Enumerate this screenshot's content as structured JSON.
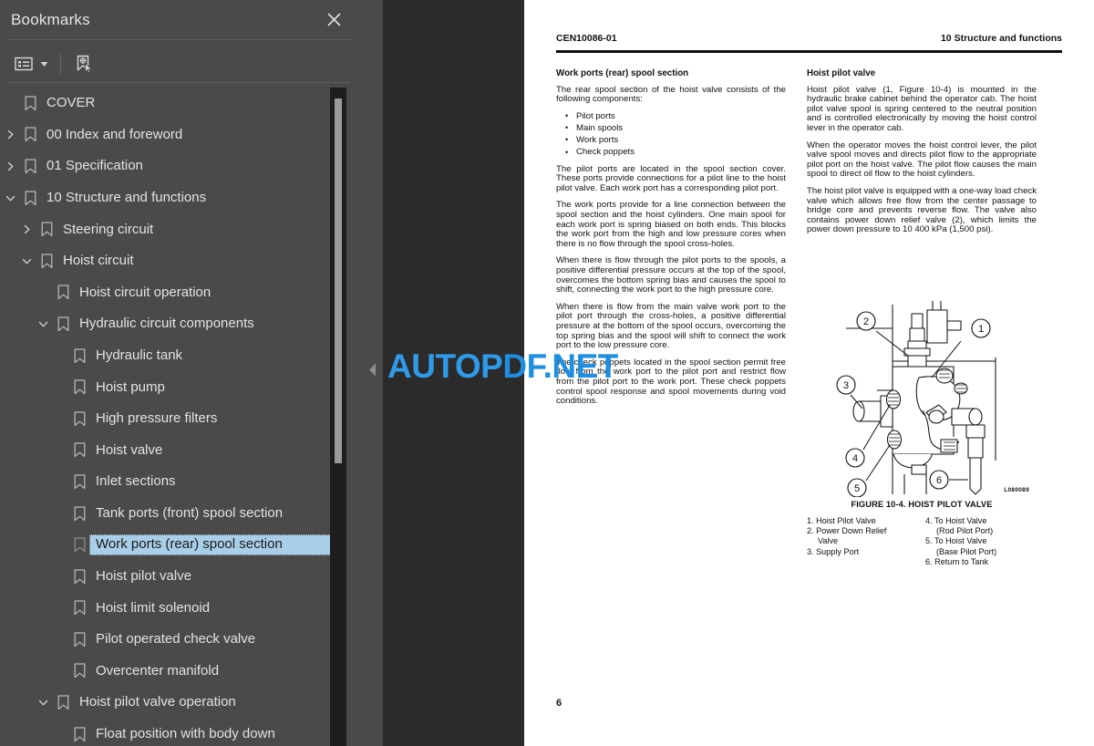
{
  "sidebar": {
    "title": "Bookmarks",
    "close_icon": "close-icon",
    "toolbar": {
      "options_icon": "list-options-icon",
      "caret_icon": "chevron-down-icon",
      "new_bookmark_icon": "new-bookmark-cursor-icon"
    },
    "tree": [
      {
        "label": "COVER",
        "level": 0,
        "state": "leaf"
      },
      {
        "label": "00 Index and foreword",
        "level": 0,
        "state": "collapsed"
      },
      {
        "label": "01 Specification",
        "level": 0,
        "state": "collapsed"
      },
      {
        "label": "10 Structure and functions",
        "level": 0,
        "state": "expanded"
      },
      {
        "label": "Steering circuit",
        "level": 1,
        "state": "collapsed"
      },
      {
        "label": "Hoist circuit",
        "level": 1,
        "state": "expanded"
      },
      {
        "label": "Hoist circuit operation",
        "level": 2,
        "state": "leaf"
      },
      {
        "label": "Hydraulic circuit components",
        "level": 2,
        "state": "expanded"
      },
      {
        "label": "Hydraulic tank",
        "level": 3,
        "state": "leaf"
      },
      {
        "label": "Hoist pump",
        "level": 3,
        "state": "leaf"
      },
      {
        "label": "High pressure filters",
        "level": 3,
        "state": "leaf"
      },
      {
        "label": "Hoist valve",
        "level": 3,
        "state": "leaf"
      },
      {
        "label": "Inlet sections",
        "level": 3,
        "state": "leaf"
      },
      {
        "label": "Tank ports (front) spool section",
        "level": 3,
        "state": "leaf"
      },
      {
        "label": "Work ports (rear) spool section",
        "level": 3,
        "state": "leaf",
        "selected": true
      },
      {
        "label": "Hoist pilot valve",
        "level": 3,
        "state": "leaf"
      },
      {
        "label": "Hoist limit solenoid",
        "level": 3,
        "state": "leaf"
      },
      {
        "label": "Pilot operated check valve",
        "level": 3,
        "state": "leaf"
      },
      {
        "label": "Overcenter manifold",
        "level": 3,
        "state": "leaf"
      },
      {
        "label": "Hoist pilot valve operation",
        "level": 2,
        "state": "expanded"
      },
      {
        "label": "Float position with body down",
        "level": 3,
        "state": "leaf"
      }
    ]
  },
  "splitter": {
    "collapse_icon": "collapse-left-arrow-icon"
  },
  "watermark": {
    "part1": "AUTOP",
    "part2": "DF.NET"
  },
  "document": {
    "header_left": "CEN10086-01",
    "header_right": "10 Structure and functions",
    "page_number": "6",
    "left_column": {
      "heading": "Work ports (rear) spool section",
      "intro": "The rear spool section of the hoist valve consists of the following components:",
      "bullets": [
        "Pilot ports",
        "Main spools",
        "Work ports",
        "Check poppets"
      ],
      "paragraphs": [
        "The pilot ports are located in the spool section cover. These ports provide connections for a pilot line to the hoist pilot valve. Each work port has a corresponding pilot port.",
        "The work ports provide for a line connection between the spool section and the hoist cylinders. One main spool for each work port is spring biased on both ends. This blocks the work port from the high and low pressure cores when there is no flow through the spool cross-holes.",
        "When there is flow through the pilot ports to the spools, a positive differential pressure occurs at the top of the spool, overcomes the bottom spring bias and causes the spool to shift, connecting the work port to the high pressure core.",
        "When there is flow from the main valve work port to the pilot port through the cross-holes, a positive differential pressure at the bottom of the spool occurs, overcoming the top spring bias and the spool will shift to connect the work port to the low pressure core.",
        "The check poppets located in the spool section permit free flow from the work port to the pilot port and restrict flow from the pilot port to the work port. These check poppets control spool response and spool movements during void conditions."
      ]
    },
    "right_column": {
      "heading": "Hoist pilot valve",
      "paragraphs": [
        "Hoist pilot valve (1, Figure 10-4) is mounted in the hydraulic brake cabinet behind the operator cab. The hoist pilot valve spool is spring centered to the neutral position and is controlled electronically by moving the hoist control lever in the operator cab.",
        "When the operator moves the hoist control lever, the pilot valve spool moves and directs pilot flow to the appropriate pilot port on the hoist valve. The pilot flow causes the main spool to direct oil flow to the hoist cylinders.",
        "The hoist pilot valve is equipped with a one-way load check valve which allows free flow from the center passage to bridge core and prevents reverse flow. The valve also contains power down relief valve (2), which limits the power down pressure to 10 400 kPa (1,500 psi)."
      ]
    },
    "figure": {
      "id": "L080089",
      "caption": "FIGURE 10-4. HOIST PILOT VALVE",
      "callouts": [
        "1",
        "2",
        "3",
        "4",
        "5",
        "6"
      ],
      "legend_left": [
        "1. Hoist Pilot Valve",
        "2. Power Down Relief",
        "Valve",
        "3. Supply Port"
      ],
      "legend_right": [
        "4. To Hoist Valve",
        "(Rod Pilot Port)",
        "5. To Hoist Valve",
        "(Base Pilot Port)",
        "6. Return to Tank"
      ]
    }
  }
}
